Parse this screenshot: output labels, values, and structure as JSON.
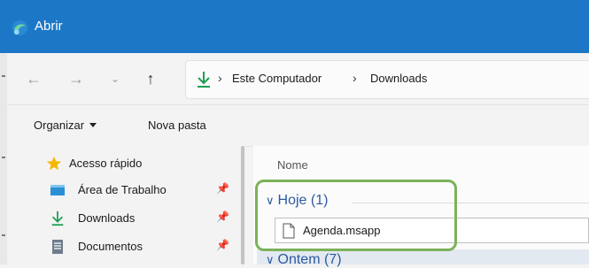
{
  "window": {
    "title": "Abrir"
  },
  "nav": {
    "back_glyph": "←",
    "forward_glyph": "→",
    "recent_glyph": "⌄",
    "up_glyph": "↑",
    "breadcrumbs": [
      "Este Computador",
      "Downloads"
    ],
    "separator": "›"
  },
  "commands": {
    "organize_label": "Organizar",
    "new_folder_label": "Nova pasta"
  },
  "sidebar": {
    "items": [
      {
        "label": "Acesso rápido",
        "icon": "star-icon"
      },
      {
        "label": "Área de Trabalho",
        "icon": "desktop-icon",
        "pin": "📌"
      },
      {
        "label": "Downloads",
        "icon": "download-icon",
        "pin": "📌"
      },
      {
        "label": "Documentos",
        "icon": "documents-icon",
        "pin": "📌"
      }
    ]
  },
  "content": {
    "column_header": "Nome",
    "groups": [
      {
        "label": "Hoje (1)",
        "chevron": "∨"
      },
      {
        "label": "Ontem (7)",
        "chevron": "∨"
      }
    ],
    "files": [
      {
        "name": "Agenda.msapp"
      }
    ]
  },
  "colors": {
    "titlebar": "#1c78c7",
    "highlight": "#7bb25a",
    "group_text": "#2c5aa0",
    "download_arrow": "#1f9f52"
  }
}
